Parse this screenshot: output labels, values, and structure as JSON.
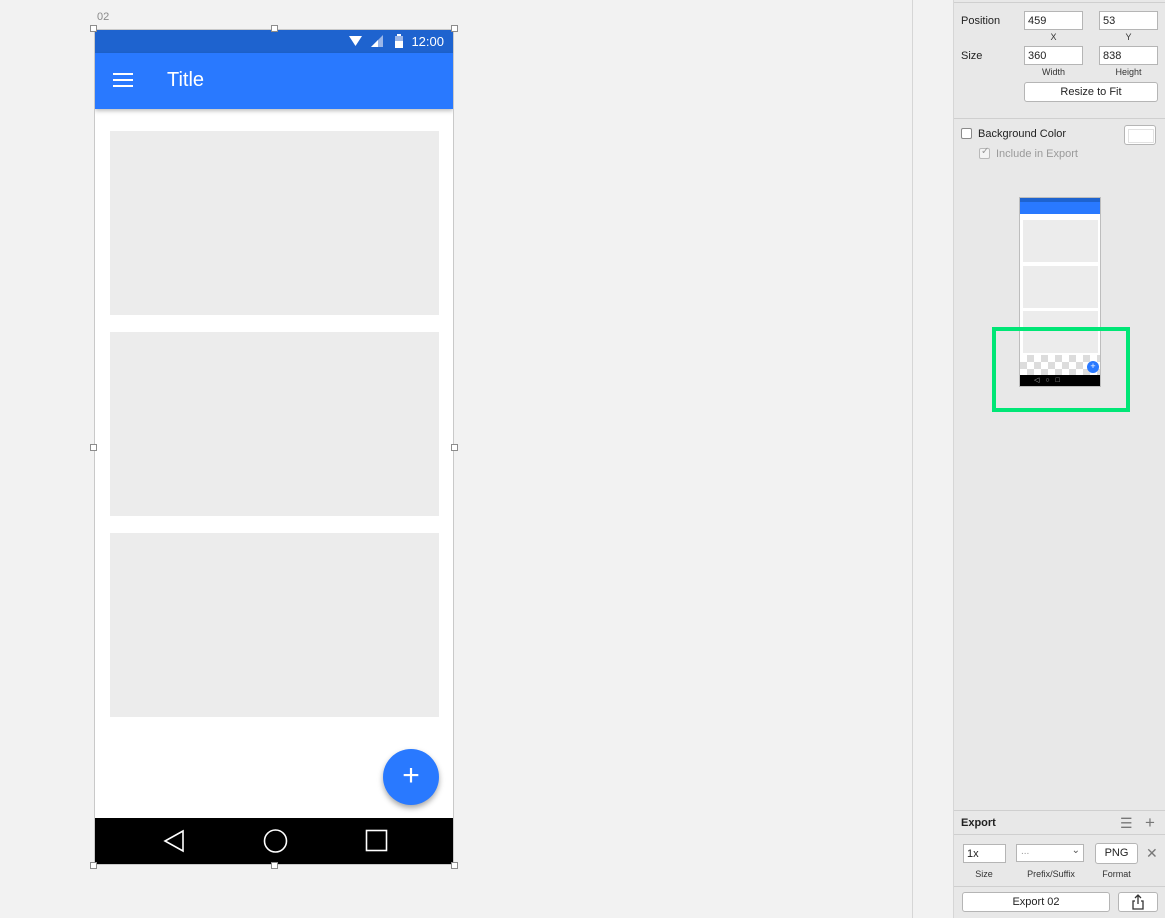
{
  "artboard": {
    "label": "02",
    "status_time": "12:00",
    "app_title": "Title",
    "fab_label": "+",
    "card_count": 3
  },
  "inspector": {
    "position": {
      "label": "Position",
      "x": "459",
      "y": "53",
      "x_label": "X",
      "y_label": "Y"
    },
    "size": {
      "label": "Size",
      "width": "360",
      "height": "838",
      "width_label": "Width",
      "height_label": "Height"
    },
    "resize_button": "Resize to Fit",
    "background_color": {
      "label": "Background Color",
      "checked": false,
      "color": "#ffffff"
    },
    "include_in_export": {
      "label": "Include in Export",
      "checked": true
    },
    "preview": {
      "fab": "+",
      "nav": "◁  ○  □"
    },
    "export": {
      "title": "Export",
      "settings_icon": "sliders-icon",
      "add_icon": "plus-icon",
      "size_value": "1x",
      "size_label": "Size",
      "prefix_value": "...",
      "prefix_label": "Prefix/Suffix",
      "format_value": "PNG",
      "format_label": "Format",
      "remove_icon": "close-icon",
      "export_button": "Export 02",
      "share_icon": "share-icon"
    }
  },
  "colors": {
    "app_bar": "#2979ff",
    "status_bar": "#1e63cf",
    "card": "#ececec",
    "highlight": "#00e676"
  }
}
